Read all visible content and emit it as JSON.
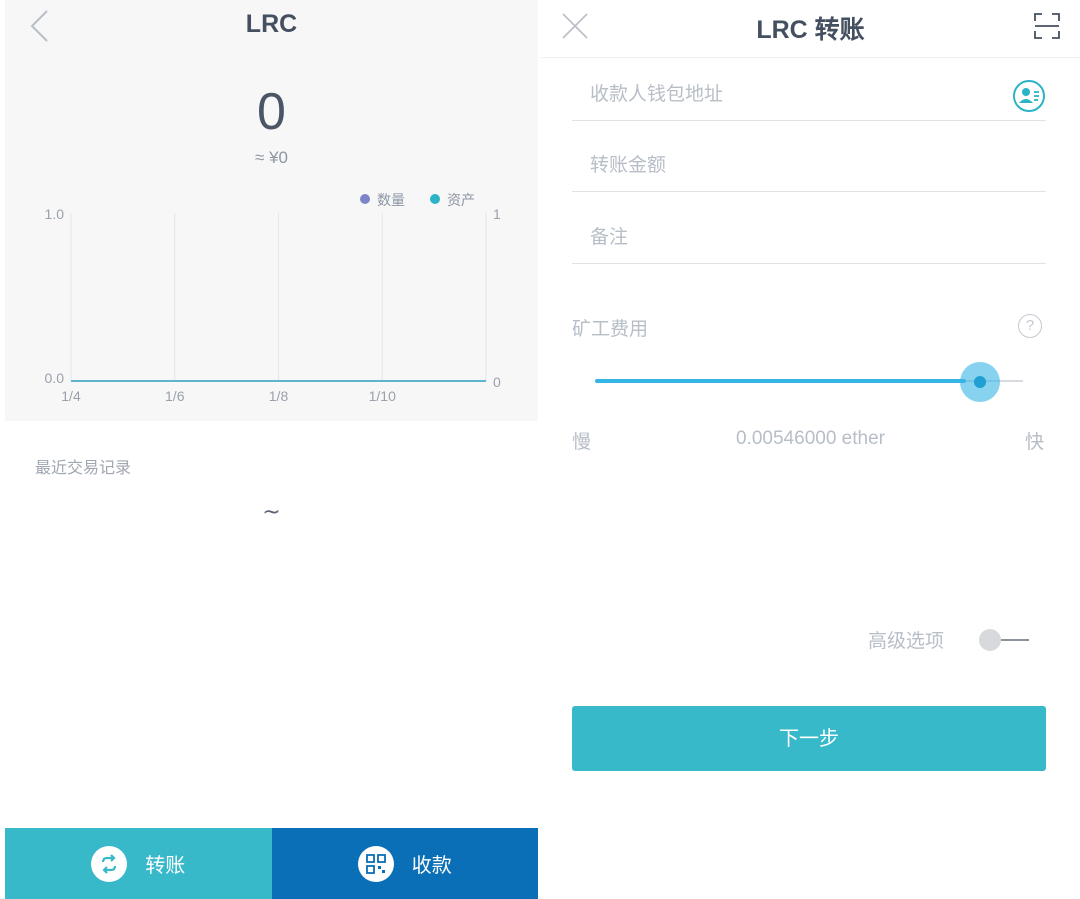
{
  "left": {
    "title": "LRC",
    "balance": "0",
    "fiat_approx": "≈ ¥0",
    "recent_label": "最近交易记录",
    "empty_marker": "~",
    "bottom_bar": {
      "transfer_label": "转账",
      "receive_label": "收款"
    }
  },
  "chart_data": {
    "type": "line",
    "legend_position": "top-right",
    "grid": "vertical",
    "x": [
      "1/4",
      "1/6",
      "1/8",
      "1/10"
    ],
    "series": [
      {
        "name": "数量",
        "axis": "left",
        "color": "#7d84c9",
        "values": [
          0,
          0,
          0,
          0
        ]
      },
      {
        "name": "资产",
        "axis": "right",
        "color": "#2ab4c6",
        "values": [
          0,
          0,
          0,
          0
        ]
      }
    ],
    "left_axis": {
      "ticks": [
        "1.0",
        "0.0"
      ],
      "ylim": [
        0,
        1
      ]
    },
    "right_axis": {
      "ticks": [
        "1",
        "0"
      ],
      "ylim": [
        0,
        1
      ]
    }
  },
  "right": {
    "title": "LRC  转账",
    "receiver_placeholder": "收款人钱包地址",
    "amount_placeholder": "转账金额",
    "memo_placeholder": "备注",
    "gas_label": "矿工费用",
    "help_glyph": "?",
    "gas_slider": {
      "level": 0.9
    },
    "slow_label": "慢",
    "fast_label": "快",
    "fee_value": "0.00546000 ether",
    "advanced_label": "高级选项",
    "advanced_enabled": false,
    "next_label": "下一步"
  },
  "colors": {
    "accent_teal": "#38b9c9",
    "accent_blue": "#0a6fb6",
    "slider_blue": "#36b4e4"
  },
  "icons": [
    "back-icon",
    "close-icon",
    "scan-icon",
    "contact-icon",
    "help-icon",
    "transfer-icon",
    "qrcode-icon"
  ]
}
